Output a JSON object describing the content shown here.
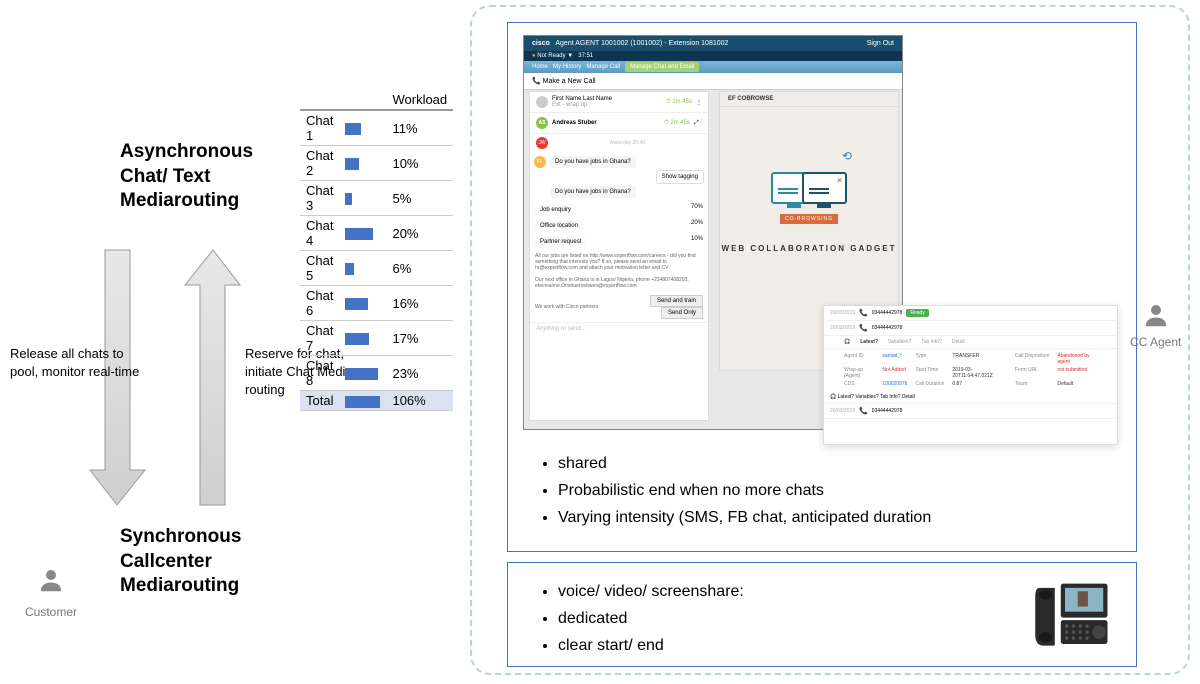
{
  "left": {
    "heading_async": "Asynchronous\nChat/ Text\nMediarouting",
    "heading_sync": "Synchronous\nCallcenter\nMediarouting",
    "arrow_left_text": "Release all chats to pool, monitor real-time",
    "arrow_right_text": "Reserve for chat, initiate Chat Media routing",
    "customer_label": "Customer"
  },
  "cc_agent_label": "CC Agent",
  "chart_data": {
    "type": "table-bar",
    "title": "Workload",
    "categories": [
      "Chat 1",
      "Chat 2",
      "Chat 3",
      "Chat 4",
      "Chat 5",
      "Chat 6",
      "Chat 7",
      "Chat 8"
    ],
    "values": [
      11,
      10,
      5,
      20,
      6,
      16,
      17,
      23
    ],
    "total_label": "Total",
    "total_value": 106,
    "unit": "%",
    "xlabel": "",
    "ylabel": ""
  },
  "top_bullets": [
    "shared",
    "Probabilistic end when no more chats",
    "Varying intensity (SMS, FB chat, anticipated duration"
  ],
  "bottom_bullets": [
    "voice/ video/ screenshare:",
    "dedicated",
    "clear start/ end"
  ],
  "app": {
    "title": "Agent AGENT 1001002 (1001002) - Extension 1081002",
    "subtitle": "Not Ready ▼",
    "sign_out": "Sign Out",
    "menu": [
      "Home",
      "My History",
      "Manage Call",
      "Manage Chat and Email"
    ],
    "call_bar": "📞  Make a New Call",
    "contact_top": {
      "name": "First Name   Last Name",
      "status": "Ext - wrap up",
      "timer": "⏱ 2m 45s"
    },
    "contact_main": {
      "name": "Andreas Stuber",
      "timer": "⏱ 2m 45s",
      "initials": "AS"
    },
    "msg_time": "Yesterday 20:40",
    "msg_q1": "Do you have jobs in Ghana?",
    "show_tagging": "Show tagging",
    "msg_q2": "Do you have jobs in Ghana?",
    "stats": [
      {
        "label": "Job enquiry",
        "val": "70%"
      },
      {
        "label": "Office location",
        "val": "20%"
      },
      {
        "label": "Partner request",
        "val": "10%"
      }
    ],
    "note1": "All our jobs are listed on http://www.expertflow.com/careers - did you find something that interests you? If so, please send an email to hr@expertflow.com and attach your motivation letter and CV",
    "note2": "Our next office in Ghana is in Lagos/ Nigeria, phone +234807408293, ebonsuone.Ometueroebwen@expertflow.com",
    "note3": "We work with Cisco partners",
    "send_train": "Send and train",
    "send_only": "Send Only",
    "input_placeholder": "Anything to send…"
  },
  "cobrowse": {
    "header": "EF COBROWSE",
    "badge": "CO-BROWSING",
    "title": "WEB COLLABORATION GADGET"
  },
  "details": {
    "date1": "20/03/2019",
    "phone1": "03444442978",
    "status1": "Ready",
    "date2": "20/03/2019",
    "phone2": "03444442978",
    "tabs": [
      "Latest?",
      "Variables?",
      "Tab Info?",
      "Detail"
    ],
    "fields": [
      {
        "l": "Agent ID",
        "v": "samad_f",
        "l2": "Type",
        "v2": "TRANSFER",
        "l3": "Call Disposition",
        "v3": "Abandoned by agent"
      },
      {
        "l": "Wrap-up (Agent)",
        "v": "Not Added",
        "l2": "Start Time",
        "v2": "2019-03-20T11:04:47.021Z",
        "l3": "Form URL",
        "v3": "not submitted"
      },
      {
        "l": "CDS",
        "v": "100020978",
        "l2": "Call Duration",
        "v2": "0.87",
        "l3": "Team",
        "v3": "Default"
      }
    ],
    "date3": "20/03/2019",
    "phone3": "03444442978"
  }
}
